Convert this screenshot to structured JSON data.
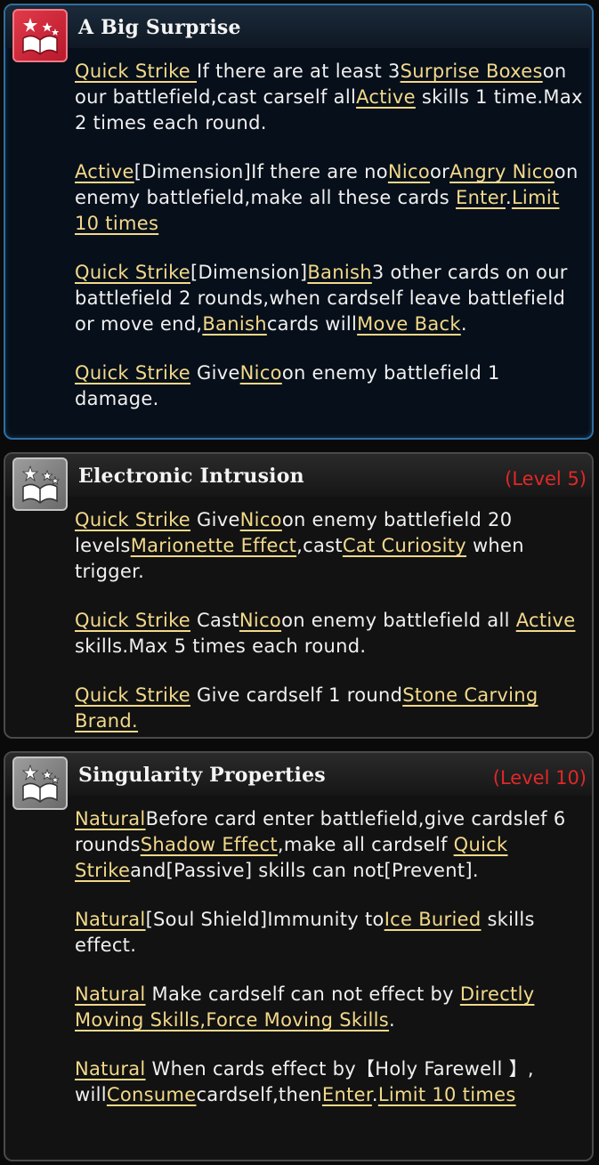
{
  "skills": [
    {
      "title": "A Big Surprise",
      "level": "",
      "icon": "spellbook-icon",
      "accent": "#c41e30"
    },
    {
      "title": "Electronic Intrusion",
      "level": "(Level 5)",
      "icon": "spellbook-icon",
      "accent": "#8a8a8a"
    },
    {
      "title": "Singularity Properties",
      "level": "(Level 10)",
      "icon": "spellbook-icon",
      "accent": "#8a8a8a"
    }
  ],
  "t": {
    "s0p0": [
      "Quick Strike ",
      "If there are at least 3",
      "Surprise Boxes",
      "on our battlefield,cast carself all",
      "Active",
      " skills 1 time.Max 2 times each round."
    ],
    "s0p1": [
      "Active",
      "[Dimension]If there are no",
      "Nico",
      "or",
      "Angry Nico",
      "on enemy battlefield,make all these cards ",
      "Enter",
      ".",
      "Limit 10 times"
    ],
    "s0p2": [
      "Quick Strike",
      "[Dimension]",
      "Banish",
      "3 other cards on our battlefield 2 rounds,when cardself leave battlefield or move end,",
      "Banish",
      "cards will",
      "Move Back",
      "."
    ],
    "s0p3": [
      "Quick Strike",
      " Give",
      "Nico",
      "on enemy battlefield 1 damage."
    ],
    "s1p0": [
      "Quick Strike",
      " Give",
      "Nico",
      "on enemy battlefield 20 levels",
      "Marionette Effect",
      ",cast",
      "Cat Curiosity",
      " when trigger."
    ],
    "s1p1": [
      "Quick Strike",
      " Cast",
      "Nico",
      "on enemy battlefield all ",
      "Active",
      " skills.Max 5 times each round."
    ],
    "s1p2": [
      "Quick Strike",
      " Give cardself 1 round",
      "Stone Carving Brand."
    ],
    "s2p0": [
      "Natural",
      "Before card enter battlefield,give cardslef 6 rounds",
      "Shadow Effect",
      ",make all cardself ",
      "Quick Strike",
      "and[Passive] skills can not[Prevent]."
    ],
    "s2p1": [
      "Natural",
      "[Soul Shield]Immunity to",
      "Ice Buried",
      " skills effect."
    ],
    "s2p2": [
      "Natural",
      " Make cardself can not effect by ",
      "Directly Moving Skills,Force Moving Skills",
      "."
    ],
    "s2p3": [
      "Natural",
      " When cards effect by【Holy Farewell 】, will",
      "Consume",
      "cardself,then",
      "Enter",
      ".",
      "Limit 10 times"
    ]
  }
}
